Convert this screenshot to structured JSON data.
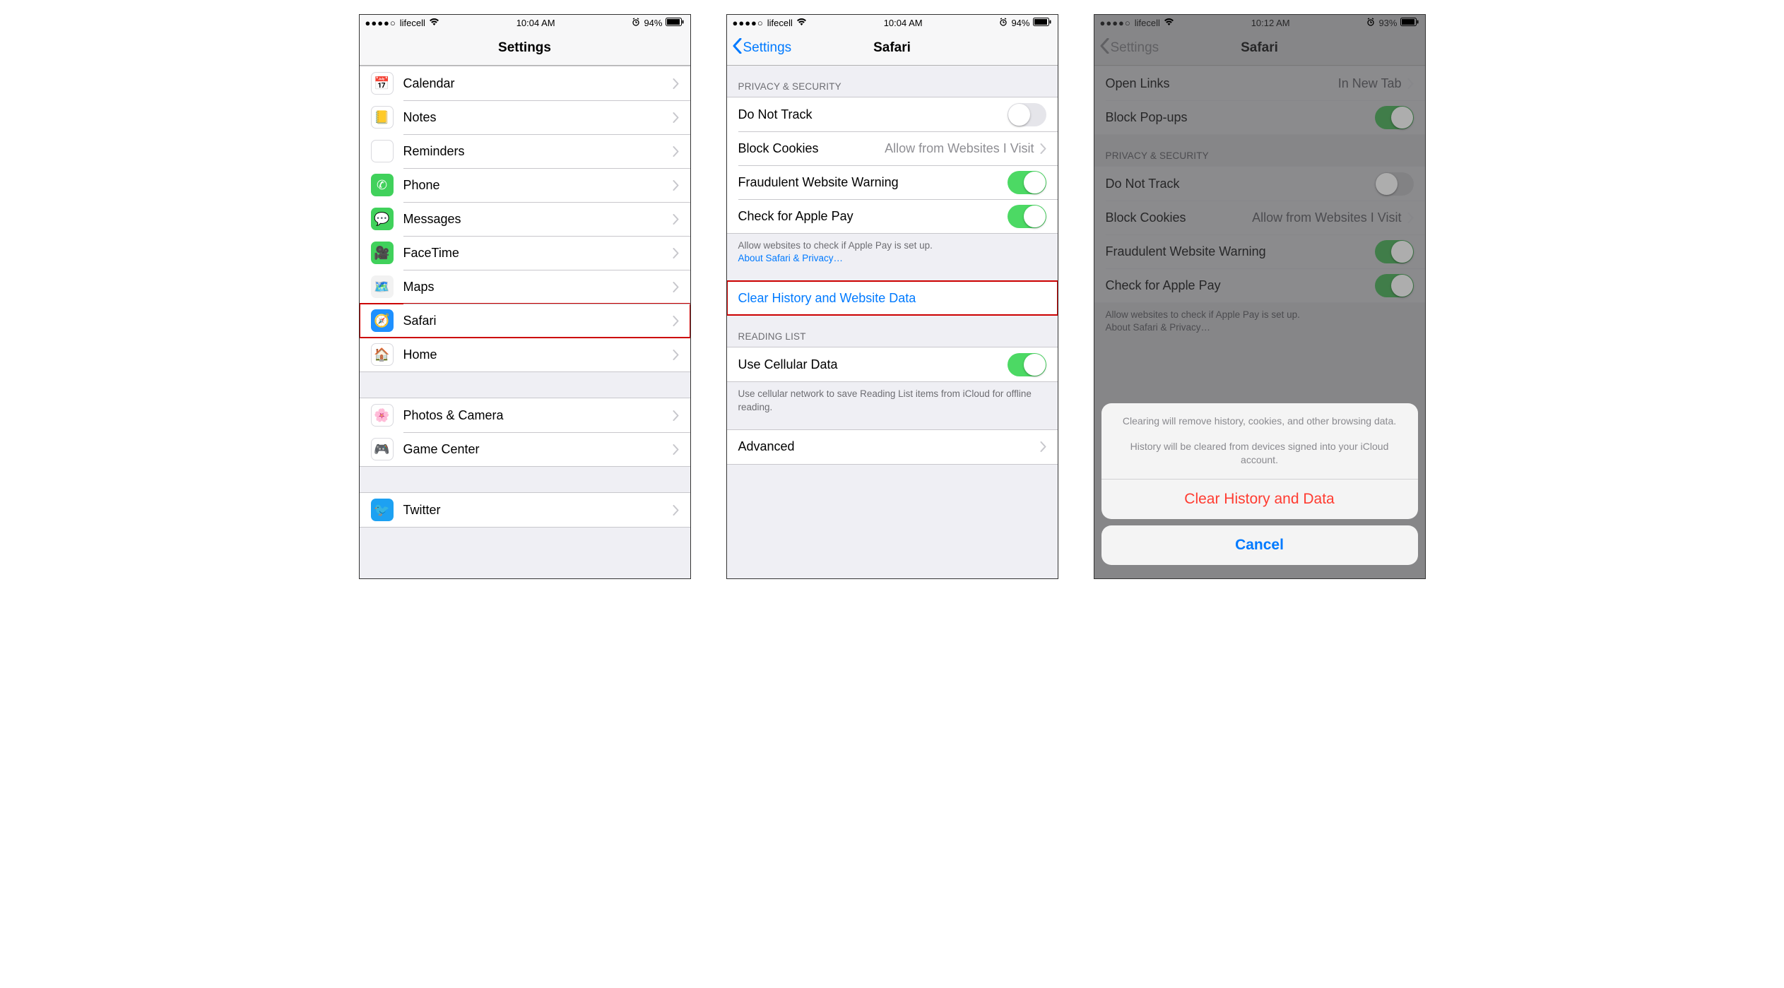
{
  "status": {
    "signal_dots": "●●●●○",
    "carrier": "lifecell",
    "time_a": "10:04 AM",
    "time_b": "10:04 AM",
    "time_c": "10:12 AM",
    "battery_a": "94%",
    "battery_b": "94%",
    "battery_c": "93%"
  },
  "screen1": {
    "title": "Settings",
    "rows": [
      {
        "icon": "calendar-icon",
        "bg": "#ffffff",
        "glyph": "📅",
        "label": "Calendar"
      },
      {
        "icon": "notes-icon",
        "bg": "#ffffff",
        "glyph": "📒",
        "label": "Notes"
      },
      {
        "icon": "reminders-icon",
        "bg": "#ffffff",
        "glyph": "≡",
        "label": "Reminders"
      },
      {
        "icon": "phone-icon",
        "bg": "#40d15b",
        "glyph": "✆",
        "label": "Phone"
      },
      {
        "icon": "messages-icon",
        "bg": "#40d15b",
        "glyph": "💬",
        "label": "Messages"
      },
      {
        "icon": "facetime-icon",
        "bg": "#40d15b",
        "glyph": "🎥",
        "label": "FaceTime"
      },
      {
        "icon": "maps-icon",
        "bg": "#f2f2f2",
        "glyph": "🗺️",
        "label": "Maps"
      },
      {
        "icon": "safari-icon",
        "bg": "#1e90ff",
        "glyph": "🧭",
        "label": "Safari",
        "highlight": true
      },
      {
        "icon": "home-icon",
        "bg": "#ffffff",
        "glyph": "🏠",
        "label": "Home"
      }
    ],
    "rows2": [
      {
        "icon": "photos-icon",
        "bg": "#ffffff",
        "glyph": "🌸",
        "label": "Photos & Camera"
      },
      {
        "icon": "gamecenter-icon",
        "bg": "#ffffff",
        "glyph": "🎮",
        "label": "Game Center"
      }
    ],
    "rows3": [
      {
        "icon": "twitter-icon",
        "bg": "#1da1f2",
        "glyph": "🐦",
        "label": "Twitter"
      }
    ]
  },
  "screen2": {
    "back": "Settings",
    "title": "Safari",
    "section1_header": "PRIVACY & SECURITY",
    "row_dnt": "Do Not Track",
    "row_cookies_label": "Block Cookies",
    "row_cookies_value": "Allow from Websites I Visit",
    "row_fraud": "Fraudulent Website Warning",
    "row_applepay": "Check for Apple Pay",
    "footer1_text": "Allow websites to check if Apple Pay is set up.",
    "footer1_link": "About Safari & Privacy…",
    "row_clear": "Clear History and Website Data",
    "section2_header": "READING LIST",
    "row_cellular": "Use Cellular Data",
    "footer2_text": "Use cellular network to save Reading List items from iCloud for offline reading.",
    "row_advanced": "Advanced"
  },
  "screen3": {
    "back": "Settings",
    "title": "Safari",
    "row_openlinks_label": "Open Links",
    "row_openlinks_value": "In New Tab",
    "row_popups": "Block Pop-ups",
    "section_header": "PRIVACY & SECURITY",
    "row_dnt": "Do Not Track",
    "row_cookies_label": "Block Cookies",
    "row_cookies_value": "Allow from Websites I Visit",
    "row_fraud": "Fraudulent Website Warning",
    "row_applepay": "Check for Apple Pay",
    "footer_text": "Allow websites to check if Apple Pay is set up.",
    "footer_link": "About Safari & Privacy…",
    "sheet_msg1": "Clearing will remove history, cookies, and other browsing data.",
    "sheet_msg2": "History will be cleared from devices signed into your iCloud account.",
    "sheet_clear": "Clear History and Data",
    "sheet_cancel": "Cancel"
  }
}
